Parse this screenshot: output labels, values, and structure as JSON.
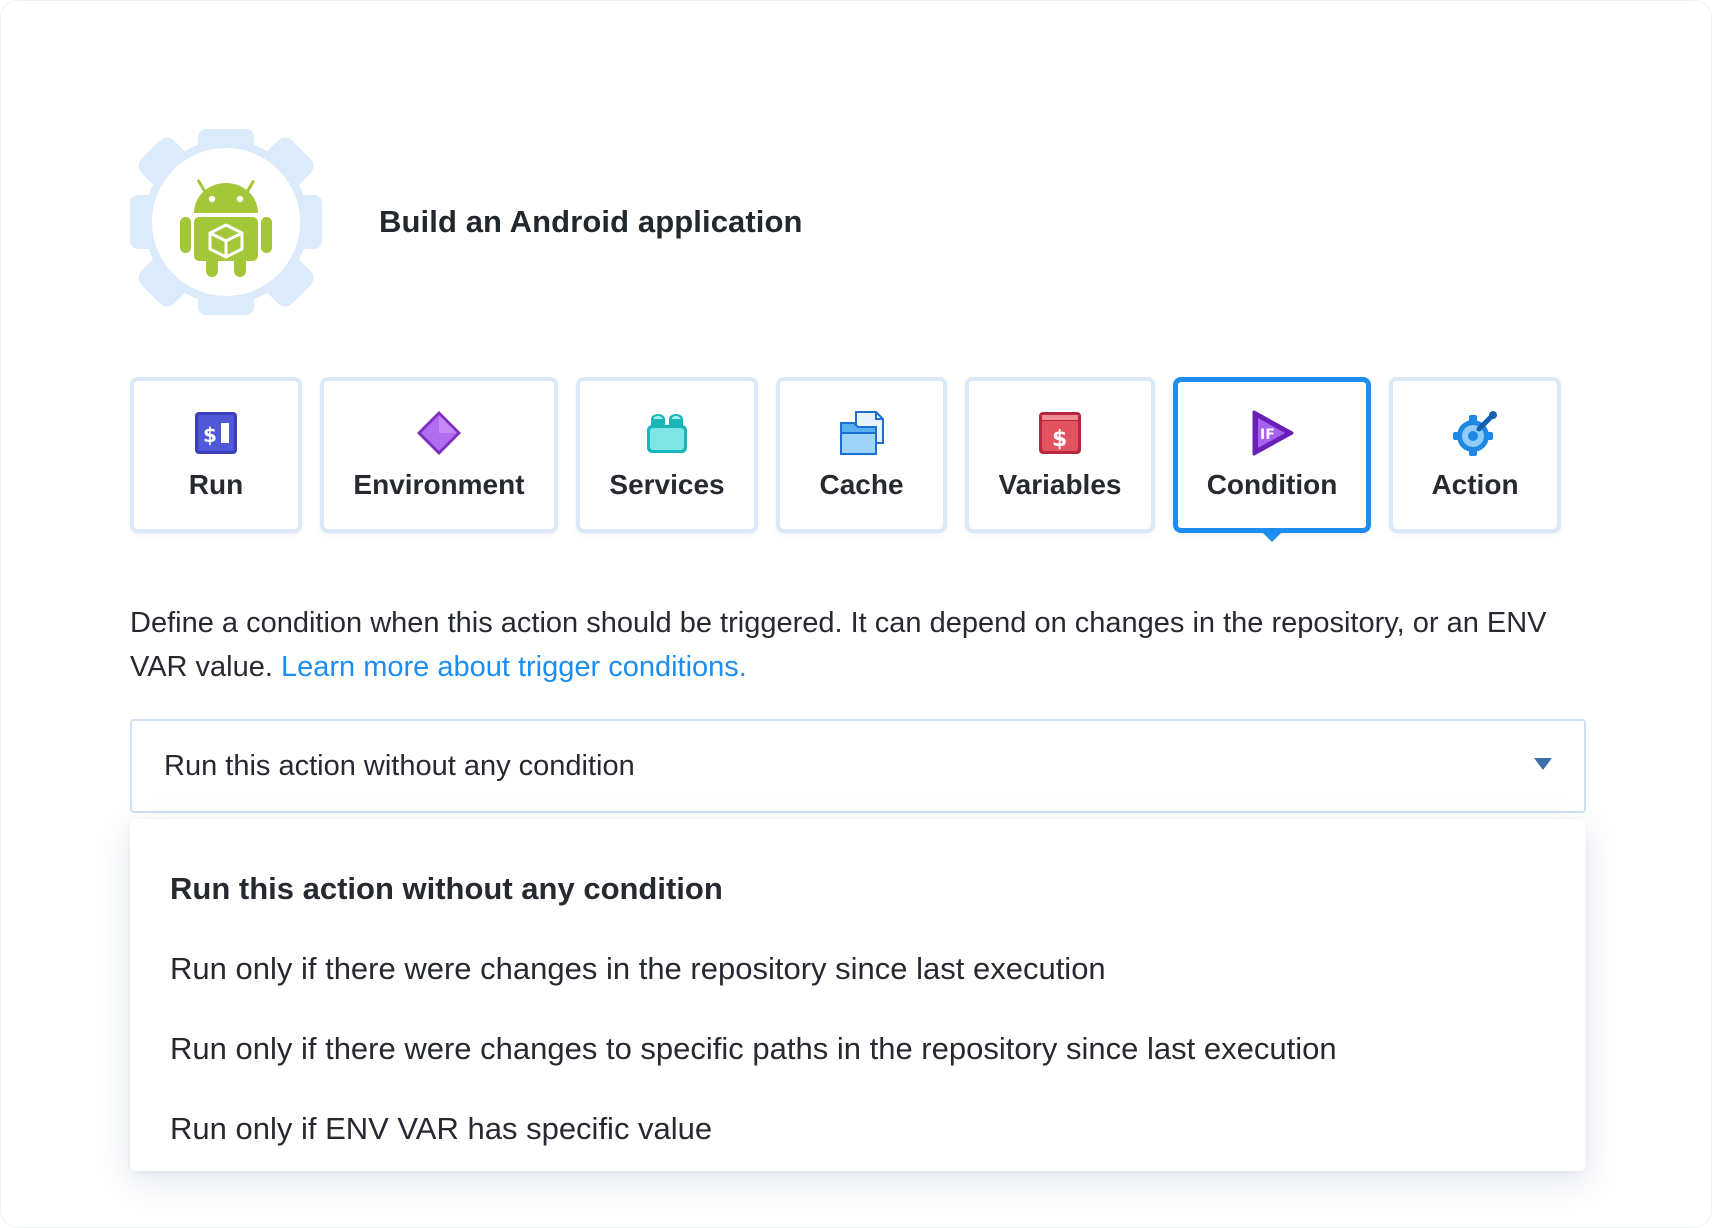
{
  "header": {
    "title": "Build an Android application",
    "icon": "android-gear-icon"
  },
  "tabs": [
    {
      "label": "Run",
      "icon": "terminal-icon",
      "active": false
    },
    {
      "label": "Environment",
      "icon": "diamond-icon",
      "active": false
    },
    {
      "label": "Services",
      "icon": "services-blocks-icon",
      "active": false
    },
    {
      "label": "Cache",
      "icon": "cache-files-icon",
      "active": false
    },
    {
      "label": "Variables",
      "icon": "variables-dollar-icon",
      "active": false
    },
    {
      "label": "Condition",
      "icon": "condition-if-icon",
      "active": true
    },
    {
      "label": "Action",
      "icon": "action-gear-icon",
      "active": false
    }
  ],
  "description": {
    "text": "Define a condition when this action should be triggered. It can depend on changes in the repository, or an ENV VAR value. ",
    "link": "Learn more about trigger conditions."
  },
  "select": {
    "value": "Run this action without any condition"
  },
  "dropdown": {
    "options": [
      "Run this action without any condition",
      "Run only if there were changes in the repository since last execution",
      "Run only if there were changes to specific paths in the repository since last execution",
      "Run only if ENV VAR has specific value"
    ],
    "selected_index": 0
  },
  "colors": {
    "accent": "#1d8df0",
    "tab_border": "#dbe8f7",
    "android_green": "#a4c639",
    "gear_bg": "#dcebfb"
  }
}
